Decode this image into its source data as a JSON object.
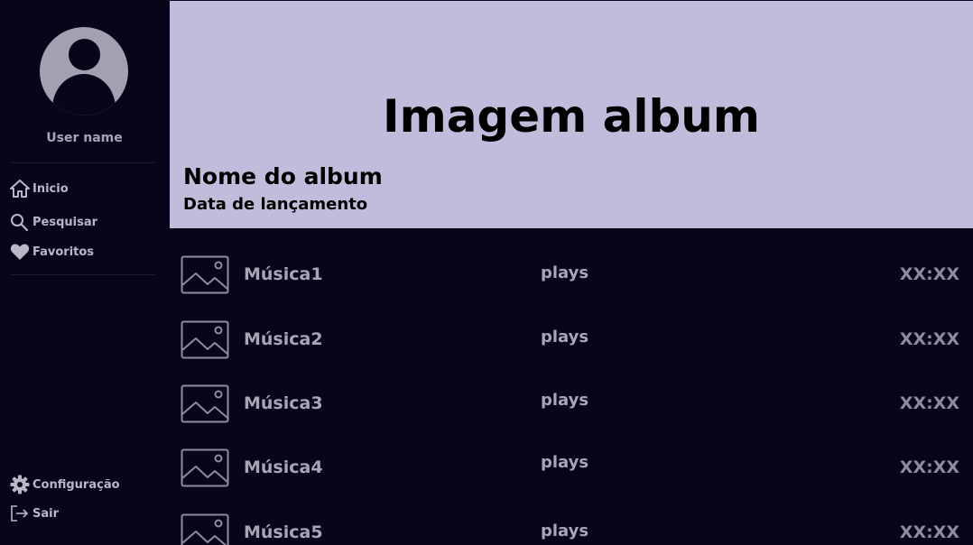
{
  "sidebar": {
    "user_name": "User name",
    "nav": [
      {
        "label": "Inicio",
        "icon": "home-icon"
      },
      {
        "label": "Pesquisar",
        "icon": "search-icon"
      },
      {
        "label": "Favoritos",
        "icon": "heart-icon"
      }
    ],
    "footer_nav": [
      {
        "label": "Configuração",
        "icon": "gear-icon"
      },
      {
        "label": "Sair",
        "icon": "logout-icon"
      }
    ]
  },
  "header": {
    "image_placeholder": "Imagem album",
    "album_name": "Nome do album",
    "release_date": "Data de lançamento"
  },
  "tracks": [
    {
      "title": "Música1",
      "plays": "plays",
      "duration": "XX:XX",
      "thumb_icon": "image-icon"
    },
    {
      "title": "Música2",
      "plays": "plays",
      "duration": "XX:XX",
      "thumb_icon": "image-icon"
    },
    {
      "title": "Música3",
      "plays": "plays",
      "duration": "XX:XX",
      "thumb_icon": "image-icon"
    },
    {
      "title": "Música4",
      "plays": "plays",
      "duration": "XX:XX",
      "thumb_icon": "image-icon"
    },
    {
      "title": "Música5",
      "plays": "plays",
      "duration": "XX:XX",
      "thumb_icon": "image-icon"
    }
  ],
  "colors": {
    "background": "#07051a",
    "header_bg": "#c1bcdb",
    "text_muted": "#a8a5b7"
  }
}
